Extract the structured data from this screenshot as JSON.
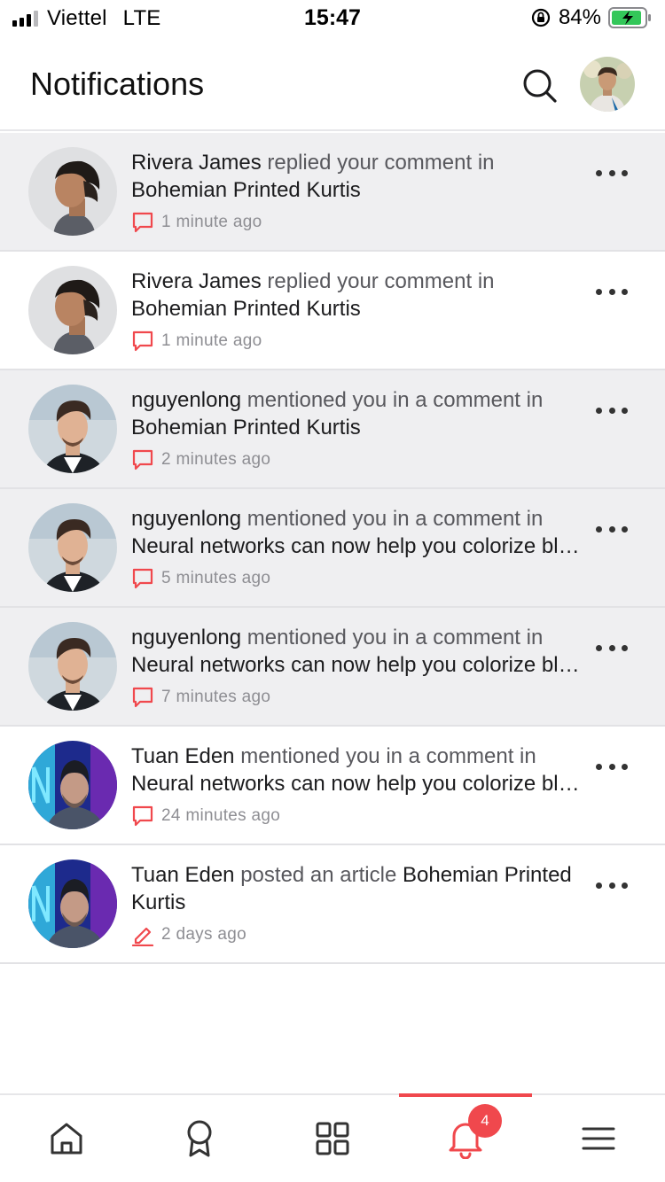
{
  "status_bar": {
    "carrier": "Viettel",
    "network": "LTE",
    "time": "15:47",
    "battery": "84%"
  },
  "header": {
    "title": "Notifications",
    "search_icon": "search-icon",
    "avatar": "user-avatar"
  },
  "notifications": [
    {
      "actor": "Rivera James",
      "action": "replied your comment in",
      "target": "Bohemian Printed Kurtis",
      "time": "1 minute ago",
      "icon": "comment-icon",
      "unread": true
    },
    {
      "actor": "Rivera James",
      "action": "replied your comment in",
      "target": "Bohemian Printed Kurtis",
      "time": "1 minute ago",
      "icon": "comment-icon",
      "unread": false
    },
    {
      "actor": "nguyenlong",
      "action": "mentioned you in a comment in",
      "target": "Bohemian Printed Kurtis",
      "time": "2 minutes ago",
      "icon": "comment-icon",
      "unread": true
    },
    {
      "actor": "nguyenlong",
      "action": "mentioned you in a comment in",
      "target": "Neural networks can now help you colorize black and white photos",
      "time": "5 minutes ago",
      "icon": "comment-icon",
      "unread": true
    },
    {
      "actor": "nguyenlong",
      "action": "mentioned you in a comment in",
      "target": "Neural networks can now help you colorize black and white photos",
      "time": "7 minutes ago",
      "icon": "comment-icon",
      "unread": true
    },
    {
      "actor": "Tuan Eden",
      "action": "mentioned you in a comment in",
      "target": "Neural networks can now help you colorize black and white photos",
      "time": "24 minutes ago",
      "icon": "comment-icon",
      "unread": false
    },
    {
      "actor": "Tuan Eden",
      "action": "posted an article",
      "target": "Bohemian Printed Kurtis",
      "time": "2 days ago",
      "icon": "pencil-icon",
      "unread": false
    }
  ],
  "tab_bar": {
    "tabs": [
      {
        "icon": "home-icon"
      },
      {
        "icon": "award-icon"
      },
      {
        "icon": "grid-icon"
      },
      {
        "icon": "bell-icon",
        "active": true
      },
      {
        "icon": "menu-icon"
      }
    ],
    "badge_count": "4"
  },
  "colors": {
    "accent": "#f0484d",
    "unread_bg": "#efeff1",
    "text_primary": "#1c1c1e",
    "text_secondary": "#58585d",
    "meta_text": "#8e8e93"
  }
}
